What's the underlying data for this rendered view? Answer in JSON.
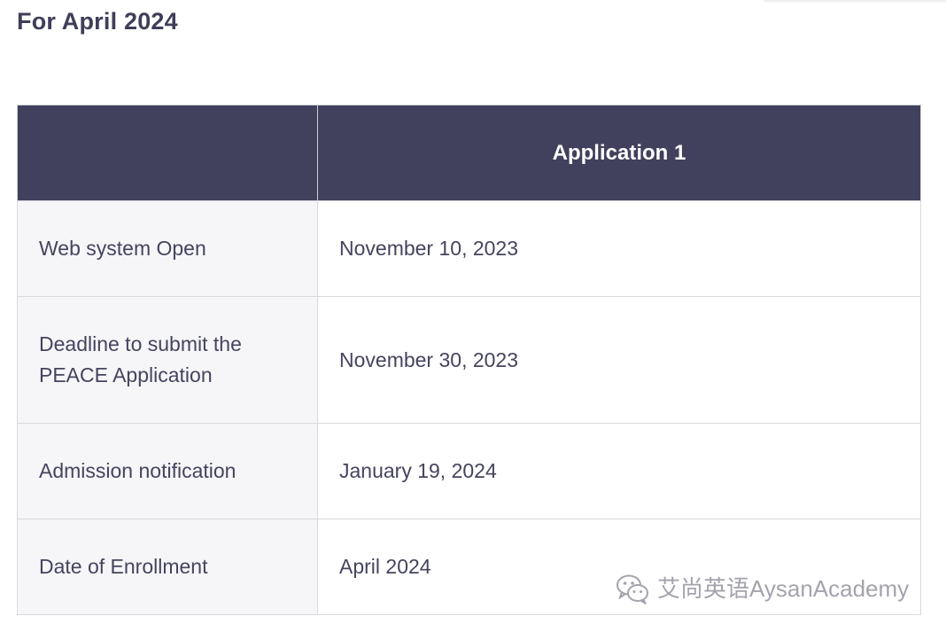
{
  "section": {
    "title": "For April 2024"
  },
  "table": {
    "header": [
      "",
      "Application 1"
    ],
    "rows": [
      {
        "label": "Web system Open",
        "value": "November 10, 2023"
      },
      {
        "label_line1": "Deadline to submit the",
        "label_line2": "PEACE Application",
        "value": "November 30, 2023"
      },
      {
        "label": "Admission notification",
        "value": "January 19, 2024"
      },
      {
        "label": "Date of Enrollment",
        "value": "April 2024"
      }
    ]
  },
  "watermark": {
    "text": "艾尚英语AysanAcademy",
    "icon": "wechat-icon"
  },
  "colors": {
    "header_bg": "#41405d",
    "label_bg": "#f6f6f9",
    "text": "#45445f",
    "border": "#d9d9de"
  }
}
